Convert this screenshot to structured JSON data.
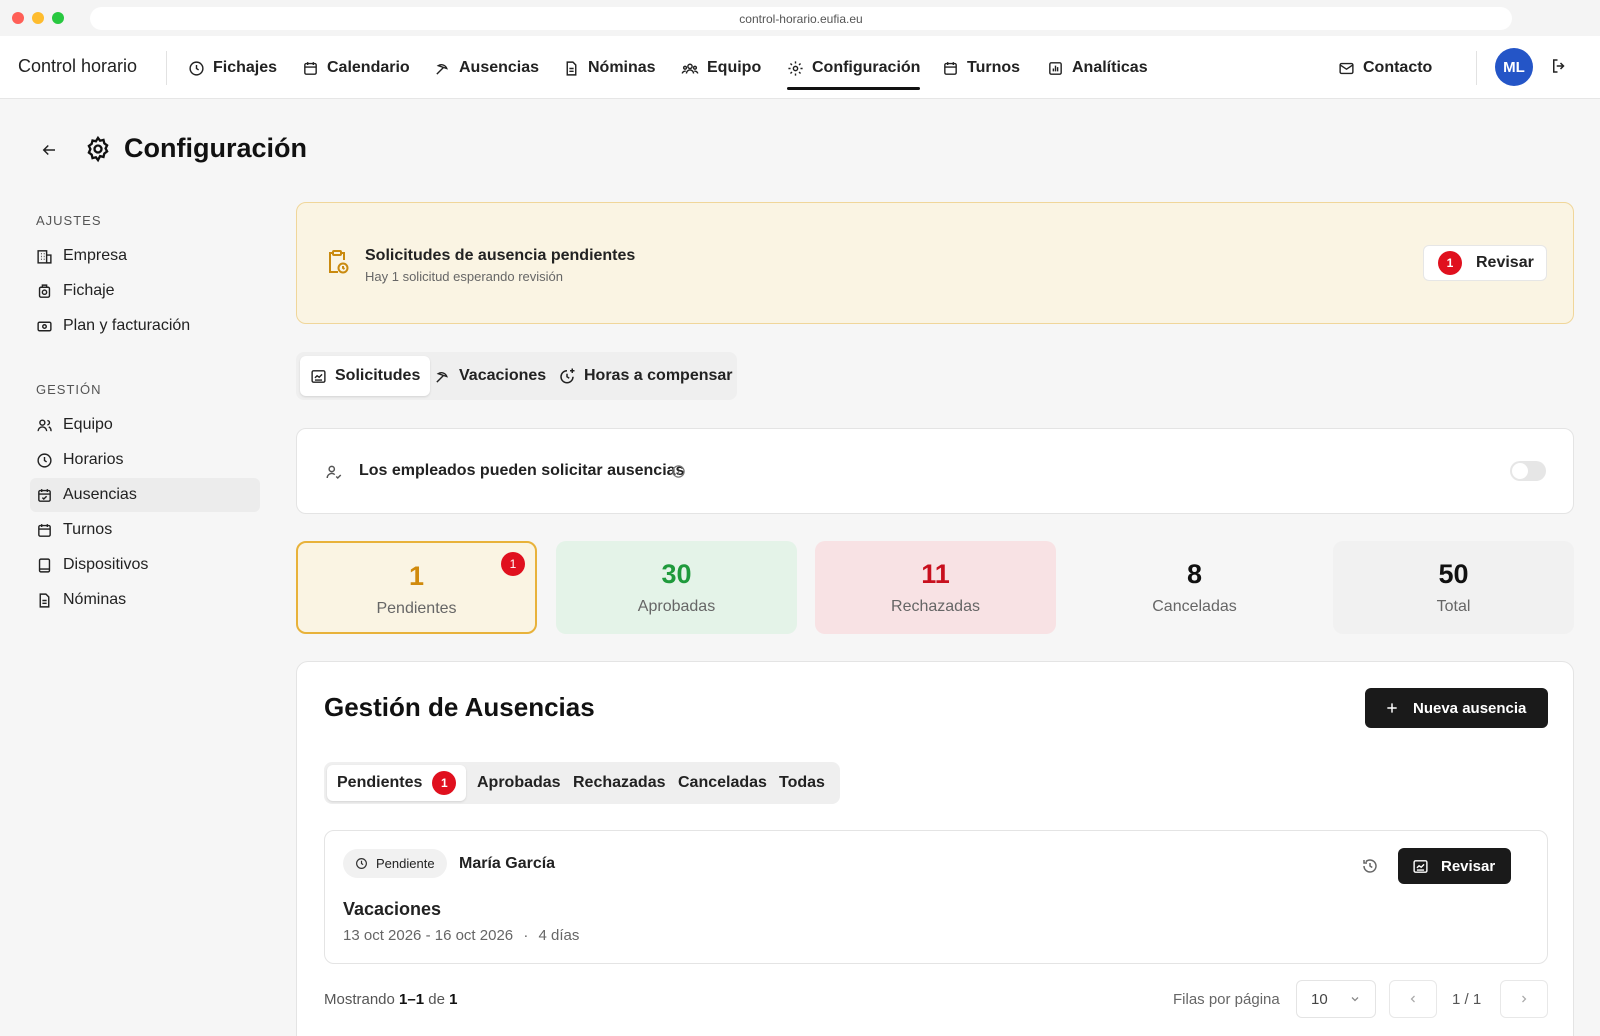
{
  "browser": {
    "url": "control-horario.eufia.eu"
  },
  "nav": {
    "brand": "Control horario",
    "items": [
      {
        "label": "Fichajes",
        "icon": "clock-icon"
      },
      {
        "label": "Calendario",
        "icon": "calendar-icon"
      },
      {
        "label": "Ausencias",
        "icon": "beach-umbrella-icon"
      },
      {
        "label": "Nóminas",
        "icon": "document-icon"
      },
      {
        "label": "Equipo",
        "icon": "team-icon"
      },
      {
        "label": "Configuración",
        "icon": "gear-icon",
        "active": true
      },
      {
        "label": "Turnos",
        "icon": "calendar-icon"
      },
      {
        "label": "Analíticas",
        "icon": "chart-icon"
      }
    ],
    "contact": "Contacto",
    "avatar_initials": "ML",
    "avatar_color": "#2455c7"
  },
  "page": {
    "title": "Configuración"
  },
  "sidebar": {
    "sections": [
      {
        "heading": "AJUSTES",
        "items": [
          {
            "label": "Empresa",
            "icon": "building-icon"
          },
          {
            "label": "Fichaje",
            "icon": "watch-icon"
          },
          {
            "label": "Plan y facturación",
            "icon": "money-icon"
          }
        ]
      },
      {
        "heading": "GESTIÓN",
        "items": [
          {
            "label": "Equipo",
            "icon": "users-icon"
          },
          {
            "label": "Horarios",
            "icon": "clock-icon"
          },
          {
            "label": "Ausencias",
            "icon": "calendar-check-icon",
            "active": true
          },
          {
            "label": "Turnos",
            "icon": "calendar-icon"
          },
          {
            "label": "Dispositivos",
            "icon": "tablet-icon"
          },
          {
            "label": "Nóminas",
            "icon": "document-icon"
          }
        ]
      }
    ]
  },
  "alert": {
    "title": "Solicitudes de ausencia pendientes",
    "subtitle": "Hay 1 solicitud esperando revisión",
    "badge": "1",
    "button": "Revisar",
    "icon": "clipboard-clock-icon"
  },
  "subtabs": [
    {
      "label": "Solicitudes",
      "icon": "inbox-icon",
      "active": true
    },
    {
      "label": "Vacaciones",
      "icon": "beach-umbrella-icon"
    },
    {
      "label": "Horas a compensar",
      "icon": "clock-plus-icon"
    }
  ],
  "toggle": {
    "label": "Los empleados pueden solicitar ausencias",
    "enabled": false
  },
  "stats": [
    {
      "value": "1",
      "label": "Pendientes",
      "badge": "1",
      "color": "#d08a0c",
      "bg": "#faf4e3"
    },
    {
      "value": "30",
      "label": "Aprobadas",
      "color": "#1f9a3c",
      "bg": "#e4f3e8"
    },
    {
      "value": "11",
      "label": "Rechazadas",
      "color": "#c8101e",
      "bg": "#f8e2e4"
    },
    {
      "value": "8",
      "label": "Canceladas",
      "color": "#111111",
      "bg": "#f6f6f6"
    },
    {
      "value": "50",
      "label": "Total",
      "color": "#111111",
      "bg": "#f1f1f1"
    }
  ],
  "management": {
    "title": "Gestión de Ausencias",
    "new_button": "Nueva ausencia",
    "filters": [
      {
        "label": "Pendientes",
        "badge": "1",
        "active": true
      },
      {
        "label": "Aprobadas"
      },
      {
        "label": "Rechazadas"
      },
      {
        "label": "Canceladas"
      },
      {
        "label": "Todas"
      }
    ],
    "request": {
      "status": "Pendiente",
      "name": "María García",
      "type": "Vacaciones",
      "dates": "13 oct 2026 - 16 oct 2026",
      "separator": "·",
      "days": "4 días",
      "button": "Revisar"
    },
    "pagination": {
      "showing_prefix": "Mostrando",
      "range": "1–1",
      "of_word": "de",
      "total": "1",
      "rows_label": "Filas por página",
      "rows_value": "10",
      "page": "1 / 1"
    }
  }
}
